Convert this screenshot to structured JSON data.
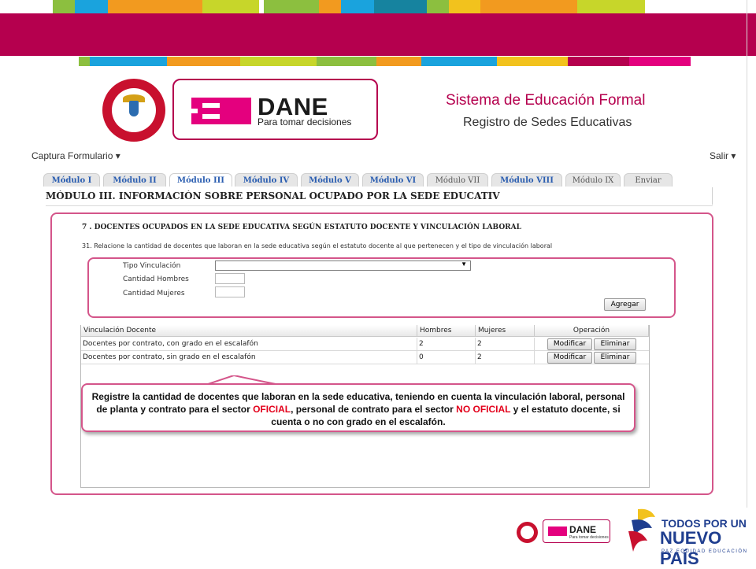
{
  "colors": {
    "brand_magenta": "#b5004e",
    "dane_pink": "#e4007e",
    "tab_text_blue": "#2a5db0",
    "highlight_red": "#e3001b",
    "stripe_palette": [
      "#8cbf3f",
      "#1aa3dd",
      "#f29a1f",
      "#c7d62a",
      "#ffffff",
      "#8cbf3f",
      "#f29a1f",
      "#1aa3dd",
      "#16839f",
      "#8cbf3f",
      "#f2c21d",
      "#f29a1f",
      "#c7d62a"
    ]
  },
  "header": {
    "seal_text": "REPÚBLICA DE COLOMBIA",
    "dane_word": "DANE",
    "dane_tagline": "Para tomar decisiones",
    "system_title": "Sistema de Educación Formal",
    "system_subtitle": "Registro de Sedes Educativas"
  },
  "nav": {
    "menu_left": "Captura Formulario ▾",
    "menu_right": "Salir ▾"
  },
  "tabs": [
    {
      "label": "Módulo I"
    },
    {
      "label": "Módulo II"
    },
    {
      "label": "Módulo III",
      "active": true
    },
    {
      "label": "Módulo IV"
    },
    {
      "label": "Módulo V"
    },
    {
      "label": "Módulo VI"
    },
    {
      "label": "Módulo VII"
    },
    {
      "label": "Módulo VIII"
    },
    {
      "label": "Módulo IX"
    },
    {
      "label": "Enviar"
    }
  ],
  "module_heading": "MÓDULO III. INFORMACIÓN SOBRE PERSONAL OCUPADO POR LA SEDE EDUCATIV",
  "section": {
    "title": "7 . DOCENTES OCUPADOS EN LA SEDE EDUCATIVA SEGÚN ESTATUTO DOCENTE Y VINCULACIÓN LABORAL",
    "question": "31. Relacione la cantidad de docentes que laboran en la sede educativa según el estatuto docente al que pertenecen y el tipo de vinculación laboral"
  },
  "form": {
    "tipo_label": "Tipo Vinculación",
    "tipo_value": "",
    "hombres_label": "Cantidad Hombres",
    "hombres_value": "",
    "mujeres_label": "Cantidad Mujeres",
    "mujeres_value": "",
    "add_button": "Agregar"
  },
  "table": {
    "headers": [
      "Vinculación Docente",
      "Hombres",
      "Mujeres",
      "Operación"
    ],
    "rows": [
      {
        "vinculacion": "Docentes por contrato, con grado en el escalafón",
        "hombres": "2",
        "mujeres": "2"
      },
      {
        "vinculacion": "Docentes por contrato, sin grado en el escalafón",
        "hombres": "0",
        "mujeres": "2"
      }
    ],
    "edit_label": "Modificar",
    "delete_label": "Eliminar"
  },
  "callout": {
    "part1": "Registre la cantidad de docentes que laboran en la sede educativa, teniendo en cuenta la vinculación laboral,  personal de planta y contrato para el sector ",
    "red1": "OFICIAL",
    "part2": ", personal de contrato para el sector ",
    "red2": "NO OFICIAL",
    "part3": " y el estatuto docente, si cuenta o no con grado en el escalafón."
  },
  "footer": {
    "dane_word": "DANE",
    "dane_tagline": "Para tomar decisiones",
    "slogan_line1": "TODOS POR UN",
    "slogan_line2": "NUEVO PAÍS",
    "slogan_line3": "PAZ  EQUIDAD  EDUCACIÓN"
  }
}
